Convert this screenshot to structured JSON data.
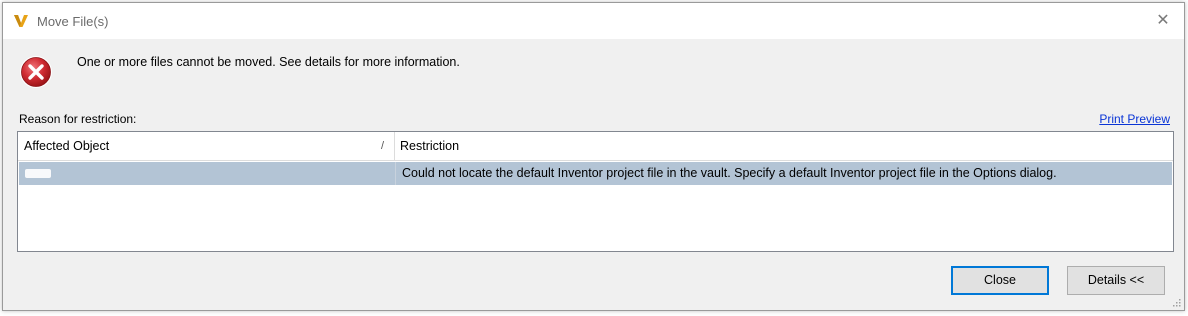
{
  "window": {
    "title": "Move File(s)",
    "app_icon": "vault-v-logo-icon",
    "close_glyph": "✕"
  },
  "message": {
    "icon": "error-icon",
    "text": "One or more files cannot be moved. See details for more information."
  },
  "reason": {
    "label": "Reason for restriction:",
    "print_preview": "Print Preview"
  },
  "grid": {
    "columns": [
      "Affected Object",
      "Restriction"
    ],
    "sort_glyph": "/",
    "rows": [
      {
        "affected_object": "",
        "restriction": "Could not locate the default Inventor project file in the vault.  Specify a default Inventor project file in the Options dialog.",
        "selected": true
      }
    ]
  },
  "buttons": {
    "close": "Close",
    "details": "Details <<"
  },
  "colors": {
    "accent": "#0078d7",
    "selected_row": "#b3c4d5",
    "error_red": "#c8242b",
    "link": "#0a35d6",
    "logo_orange": "#e8a317"
  }
}
